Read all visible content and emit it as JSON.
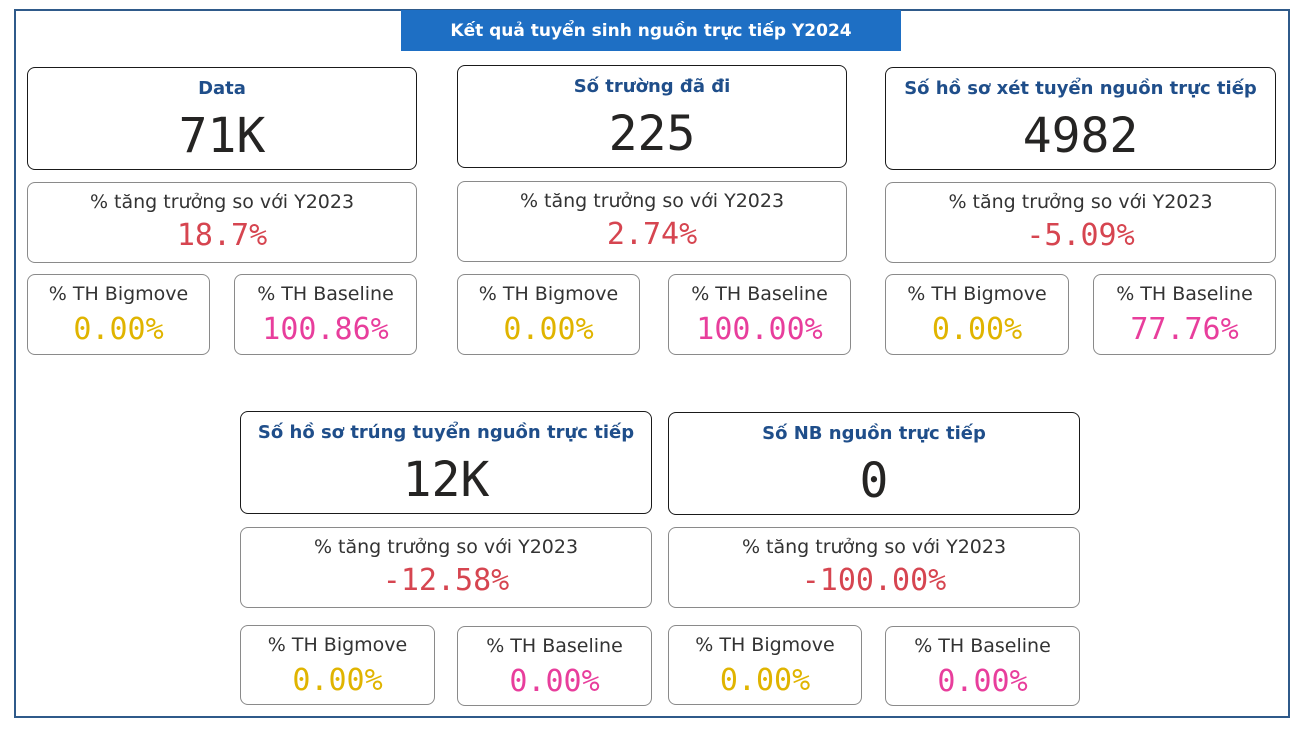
{
  "header": {
    "title": "Kết quả tuyển sinh nguồn trực tiếp Y2024"
  },
  "labels": {
    "growth": "% tăng trưởng so với Y2023",
    "bigmove": "% TH Bigmove",
    "baseline": "% TH Baseline"
  },
  "colors": {
    "banner": "#1e6fc4",
    "title": "#1f4e8a",
    "growth": "#d64550",
    "bigmove": "#e0b400",
    "baseline": "#e83e9c",
    "frame": "#2f5a8a"
  },
  "kpis": [
    {
      "title": "Data",
      "value": "71K",
      "growth": "18.7%",
      "bigmove": "0.00%",
      "baseline": "100.86%"
    },
    {
      "title": "Số trường đã đi",
      "value": "225",
      "growth": "2.74%",
      "bigmove": "0.00%",
      "baseline": "100.00%"
    },
    {
      "title": "Số hồ sơ xét tuyển nguồn trực tiếp",
      "value": "4982",
      "growth": "-5.09%",
      "bigmove": "0.00%",
      "baseline": "77.76%"
    },
    {
      "title": "Số hồ sơ trúng tuyển nguồn trực tiếp",
      "value": "12K",
      "growth": "-12.58%",
      "bigmove": "0.00%",
      "baseline": "0.00%"
    },
    {
      "title": "Số NB nguồn trực tiếp",
      "value": "0",
      "growth": "-100.00%",
      "bigmove": "0.00%",
      "baseline": "0.00%"
    }
  ]
}
